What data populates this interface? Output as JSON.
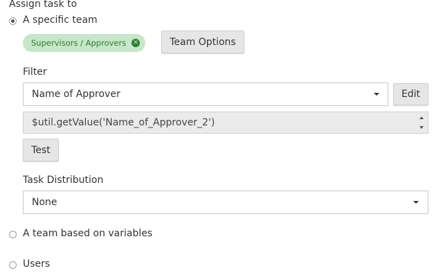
{
  "section_title": "Assign task to",
  "options": {
    "specific_team": "A specific team",
    "team_variables": "A team based on variables",
    "users": "Users"
  },
  "selected_team": {
    "chip_label": "Supervisors / Approvers",
    "team_options_button": "Team Options"
  },
  "filter": {
    "label": "Filter",
    "selected_value": "Name of Approver",
    "edit_button": "Edit",
    "expression": "$util.getValue('Name_of_Approver_2')",
    "test_button": "Test"
  },
  "task_distribution": {
    "label": "Task Distribution",
    "selected_value": "None"
  },
  "colors": {
    "chip_bg": "#c8e6c9",
    "chip_text": "#2e7d32"
  }
}
